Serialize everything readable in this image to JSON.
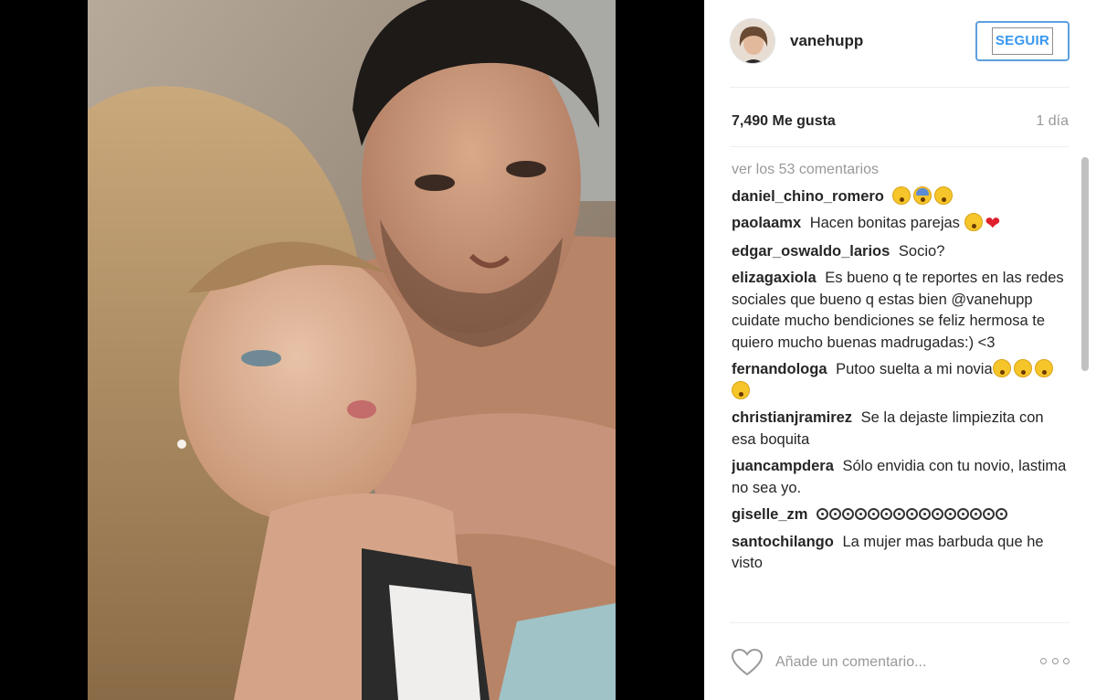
{
  "post": {
    "username": "vanehupp",
    "follow_label": "SEGUIR",
    "likes": "7,490 Me gusta",
    "time": "1 día",
    "view_all": "ver los 53 comentarios",
    "comment_placeholder": "Añade un comentario...",
    "accent_color": "#3897f0"
  },
  "comments": [
    {
      "user": "daniel_chino_romero",
      "text": "",
      "emojis": [
        "yellow",
        "blue",
        "yellow"
      ]
    },
    {
      "user": "paolaamx",
      "text": "Hacen bonitas parejas",
      "emojis": [
        "yellow",
        "heart"
      ]
    },
    {
      "user": "edgar_oswaldo_larios",
      "text": "Socio?"
    },
    {
      "user": "elizagaxiola",
      "text": "Es bueno q te reportes en las redes sociales que bueno q estas bien @vanehupp cuidate mucho bendiciones se feliz hermosa te quiero mucho buenas madrugadas:) <3"
    },
    {
      "user": "fernandologa",
      "text": "Putoo suelta a mi novia",
      "emojis": [
        "yellow",
        "yellow",
        "yellow",
        "yellow"
      ]
    },
    {
      "user": "christianjramirez",
      "text": "Se la dejaste limpiezita con esa boquita"
    },
    {
      "user": "juancampdera",
      "text": "Sólo envidia con tu novio, lastima no sea yo."
    },
    {
      "user": "giselle_zm",
      "text": "",
      "dots": 15
    },
    {
      "user": "santochilango",
      "text": "La mujer mas barbuda que he visto"
    }
  ]
}
